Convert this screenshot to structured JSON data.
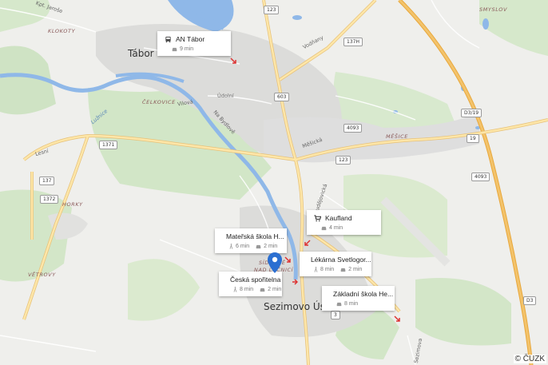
{
  "map": {
    "attribution": "© ČUZK",
    "towns": {
      "tabor": "Tábor",
      "sezimovo_usti": "Sezimovo Ústí"
    },
    "localities": {
      "klokoty": "KLOKOTY",
      "celkovice": "ČELKOVICE",
      "horky": "HORKY",
      "vetrovy": "VĚTROVY",
      "mesice": "MĚŠICE",
      "smyslov": "SMYSLOV",
      "sidliste": "SÍDLIŠTĚ",
      "nad_lucnici": "NAD LUČNICÍ"
    },
    "streets": {
      "kpt_jarose": "Kpt. Jaroše",
      "vodnany": "Vodňany",
      "udolni": "Údolní",
      "vilova": "Vilová",
      "na_bydlove": "Na Bydlově",
      "mesicka": "Měšická",
      "lesni": "Lesní",
      "budejovicka": "Budějovická",
      "sezimova": "Sezimova"
    },
    "water": {
      "luznice": "Lužnice"
    },
    "road_shields": [
      "123",
      "137H",
      "603",
      "4093",
      "123",
      "1371",
      "137",
      "1372",
      "4093",
      "19",
      "D3/19",
      "D3",
      "3"
    ]
  },
  "pois": [
    {
      "icon": "bus-icon",
      "name": "AN Tábor",
      "car": "9 min"
    },
    {
      "icon": "cart-icon",
      "name": "Kaufland",
      "car": "4 min"
    },
    {
      "icon": "school-icon",
      "name": "Mateřská škola H...",
      "walk": "6 min",
      "car": "2 min"
    },
    {
      "icon": "cart-icon",
      "name": "Lékárna Svetlogor...",
      "walk": "8 min",
      "car": "2 min"
    },
    {
      "icon": "bank-icon",
      "name": "Česká spořitelna",
      "walk": "8 min",
      "car": "2 min"
    },
    {
      "icon": "school-icon",
      "name": "Základní škola He...",
      "car": "8 min"
    }
  ],
  "colors": {
    "forest": "#cfe3c4",
    "water": "#8fb8e8",
    "urban": "#dcdcda",
    "highway": "#f3c36b",
    "main_road": "#fde6a8",
    "marker": "#2b6fd1"
  }
}
